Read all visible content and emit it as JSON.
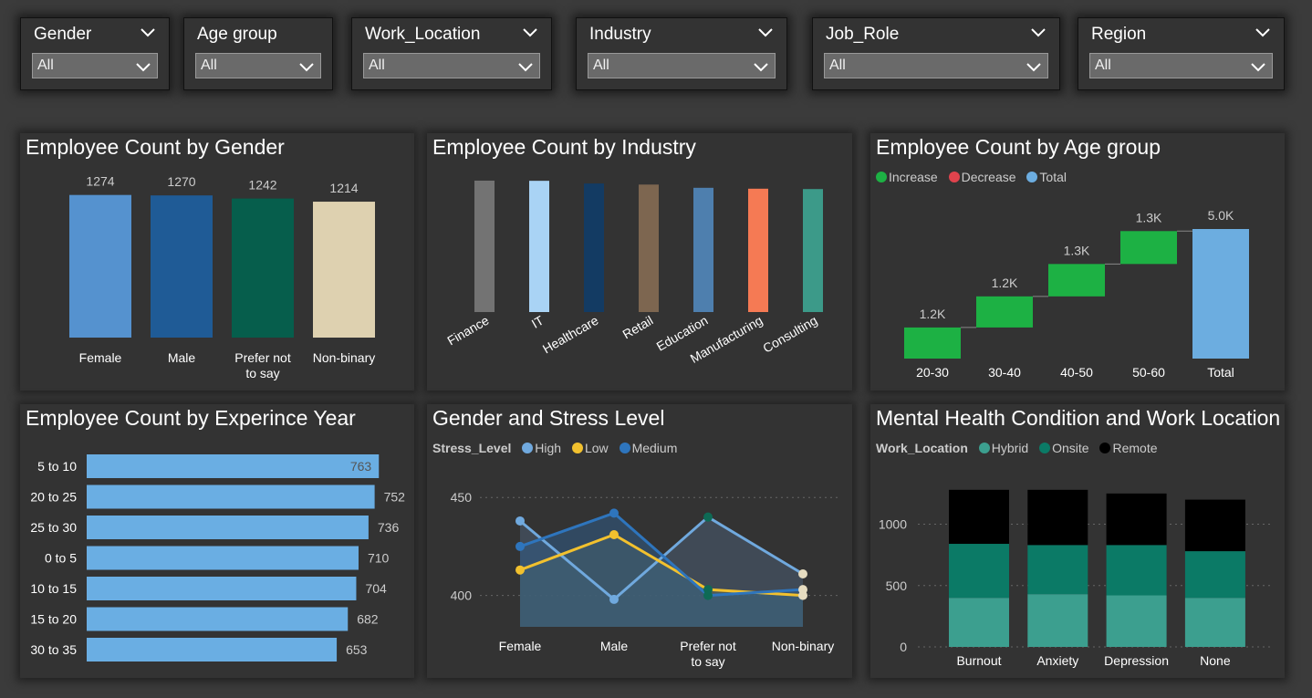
{
  "slicers": [
    {
      "label": "Gender",
      "value": "All"
    },
    {
      "label": "Age group",
      "value": "All"
    },
    {
      "label": "Work_Location",
      "value": "All"
    },
    {
      "label": "Industry",
      "value": "All"
    },
    {
      "label": "Job_Role",
      "value": "All"
    },
    {
      "label": "Region",
      "value": "All"
    }
  ],
  "colors": {
    "gender": [
      "#5592cf",
      "#1f5b96",
      "#065e4c",
      "#ded1b0"
    ],
    "industry": [
      "#737373",
      "#a9d3f5",
      "#133b63",
      "#7d6650",
      "#4e7fae",
      "#f57a54",
      "#3c9a89"
    ],
    "increase": "#1db144",
    "decrease": "#e0434d",
    "total": "#6cade0",
    "bar": "#6aaee3",
    "stress": {
      "High": "#70a9de",
      "Low": "#f2c12e",
      "Medium": "#2e75bd"
    },
    "work_location": {
      "Hybrid": "#3c9f8f",
      "Onsite": "#0b7a66",
      "Remote": "#000000"
    }
  },
  "chart_data": [
    {
      "id": "gender",
      "type": "bar",
      "title": "Employee Count by Gender",
      "categories": [
        "Female",
        "Male",
        "Prefer not to say",
        "Non-binary"
      ],
      "values": [
        1274,
        1270,
        1242,
        1214
      ],
      "data_labels": [
        "1274",
        "1270",
        "1242",
        "1214"
      ]
    },
    {
      "id": "industry",
      "type": "bar",
      "title": "Employee Count by Industry",
      "categories": [
        "Finance",
        "IT",
        "Healthcare",
        "Retail",
        "Education",
        "Manufacturing",
        "Consulting"
      ],
      "values": [
        733,
        732,
        717,
        711,
        693,
        688,
        686
      ]
    },
    {
      "id": "age",
      "type": "bar",
      "subtype": "waterfall",
      "title": "Employee Count by Age group",
      "legend": [
        "Increase",
        "Decrease",
        "Total"
      ],
      "categories": [
        "20-30",
        "30-40",
        "40-50",
        "50-60",
        "Total"
      ],
      "values": [
        1200,
        1200,
        1250,
        1270,
        5000
      ],
      "data_labels": [
        "1.2K",
        "1.2K",
        "1.3K",
        "1.3K",
        "5.0K"
      ]
    },
    {
      "id": "experience",
      "type": "bar",
      "orientation": "horizontal",
      "title": "Employee Count by Experince Year",
      "categories": [
        "5 to 10",
        "20 to 25",
        "25 to 30",
        "0 to 5",
        "10 to 15",
        "15 to 20",
        "30 to 35"
      ],
      "values": [
        763,
        752,
        736,
        710,
        704,
        682,
        653
      ],
      "data_labels": [
        "763",
        "752",
        "736",
        "710",
        "704",
        "682",
        "653"
      ]
    },
    {
      "id": "stress",
      "type": "area",
      "title": "Gender and Stress Level",
      "legend_title": "Stress_Level",
      "categories": [
        "Female",
        "Male",
        "Prefer not to say",
        "Non-binary"
      ],
      "series": [
        {
          "name": "High",
          "values": [
            438,
            398,
            440,
            411
          ]
        },
        {
          "name": "Low",
          "values": [
            413,
            431,
            403,
            400
          ]
        },
        {
          "name": "Medium",
          "values": [
            425,
            442,
            400,
            403
          ]
        }
      ],
      "y_ticks": [
        "450",
        "400"
      ],
      "ylim": [
        384,
        458
      ]
    },
    {
      "id": "mental",
      "type": "bar",
      "subtype": "stacked",
      "title": "Mental Health Condition and Work Location",
      "legend_title": "Work_Location",
      "categories": [
        "Burnout",
        "Anxiety",
        "Depression",
        "None"
      ],
      "series": [
        {
          "name": "Hybrid",
          "values": [
            400,
            430,
            420,
            400
          ]
        },
        {
          "name": "Onsite",
          "values": [
            440,
            400,
            410,
            380
          ]
        },
        {
          "name": "Remote",
          "values": [
            440,
            450,
            420,
            420
          ]
        }
      ],
      "y_ticks": [
        "1000",
        "500",
        "0"
      ],
      "ylim": [
        0,
        1350
      ]
    }
  ]
}
